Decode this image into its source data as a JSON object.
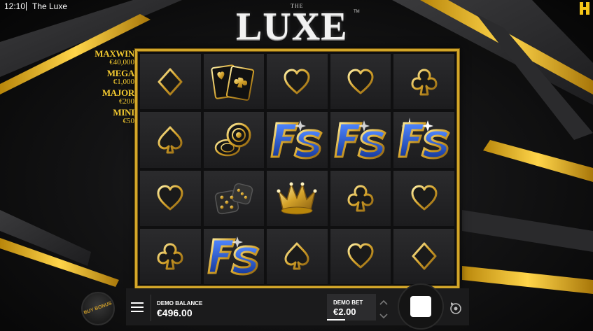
{
  "status_bar": {
    "time": "12:10",
    "app_title": "The Luxe"
  },
  "logo": {
    "the": "THE",
    "word": "LUXE",
    "tm": "TM"
  },
  "jackpots": [
    {
      "name": "MAXWIN",
      "value": "€40,000"
    },
    {
      "name": "MEGA",
      "value": "€1,000"
    },
    {
      "name": "MAJOR",
      "value": "€200"
    },
    {
      "name": "MINI",
      "value": "€50"
    }
  ],
  "reels": [
    [
      "diamond",
      "cards",
      "heart",
      "heart",
      "club"
    ],
    [
      "spade",
      "chips",
      "fs",
      "fs",
      "fs-glow"
    ],
    [
      "heart",
      "dice",
      "crown",
      "club",
      "heart"
    ],
    [
      "club",
      "fs",
      "spade",
      "heart",
      "diamond"
    ]
  ],
  "bottom": {
    "buy_bonus_label": "BUY BONUS",
    "balance_label": "DEMO BALANCE",
    "balance_value": "€496.00",
    "bet_label": "DEMO BET",
    "bet_value": "€2.00"
  },
  "colors": {
    "gold": "#d3a72a",
    "jackpot": "#f3c930",
    "fs_blue": "#2a58c9"
  },
  "icons": {
    "menu": "hamburger-menu-icon",
    "spin": "spin-stop-icon",
    "autoplay": "autoplay-icon",
    "arrows": "bet-arrows-icon"
  }
}
